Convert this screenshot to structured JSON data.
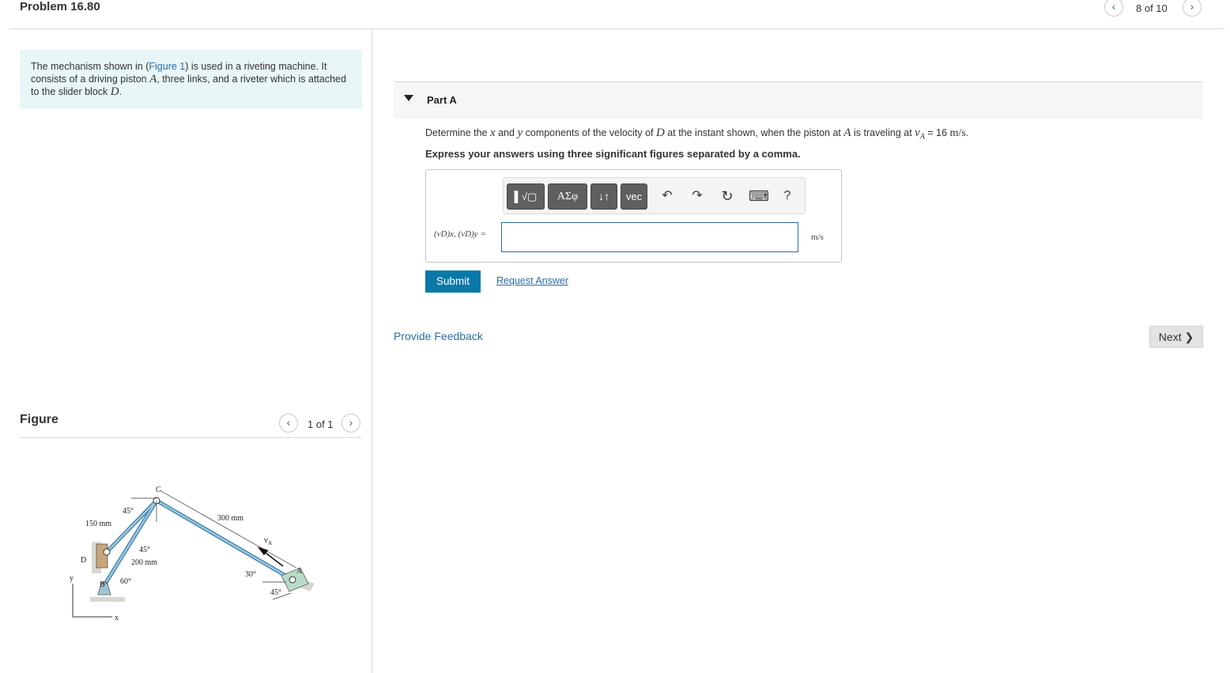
{
  "header": {
    "title": "Problem 16.80",
    "pager_text": "8 of 10",
    "prev_glyph": "‹",
    "next_glyph": "›"
  },
  "intro": {
    "text_before": "The mechanism shown in (",
    "figure_link": "Figure 1",
    "text_middle_1": ") is used in a riveting machine. It consists of a driving piston ",
    "var_A": "A",
    "text_middle_2": ", three links, and a riveter which is attached to the slider block ",
    "var_D": "D",
    "text_end": "."
  },
  "figure": {
    "title": "Figure",
    "pager_text": "1 of 1",
    "labels": {
      "C": "C",
      "A": "A",
      "B": "B",
      "D": "D",
      "y": "y",
      "x": "x",
      "vA": "v",
      "vA_sub": "A",
      "dim_150": "150 mm",
      "dim_200": "200 mm",
      "dim_300": "300 mm",
      "ang_45_top": "45°",
      "ang_45_mid": "45°",
      "ang_60": "60°",
      "ang_30": "30°",
      "ang_45_bot": "45°"
    }
  },
  "part": {
    "label": "Part A",
    "question_1": "Determine the ",
    "var_x": "x",
    "question_2": " and ",
    "var_y": "y",
    "question_3": " components of the velocity of ",
    "var_D": "D",
    "question_4": " at the instant shown, when the piston at ",
    "var_A": "A",
    "question_5": " is traveling at ",
    "v_A": "v",
    "v_A_sub": "A",
    "question_6": " = 16 ",
    "unit": "m/s",
    "question_7": ".",
    "express": "Express your answers using three significant figures separated by a comma."
  },
  "toolbar": {
    "templates": "▌√▢",
    "greek": "ΑΣφ",
    "arrows": "↓↑",
    "vec": "vec",
    "undo": "↶",
    "redo": "↷",
    "reset": "↻",
    "keyboard": "⌨",
    "help": "?"
  },
  "answer": {
    "label": "(vD)x, (vD)y =",
    "value": "",
    "unit": "m/s"
  },
  "actions": {
    "submit": "Submit",
    "request_answer": "Request Answer",
    "feedback": "Provide Feedback",
    "next": "Next ❯"
  }
}
